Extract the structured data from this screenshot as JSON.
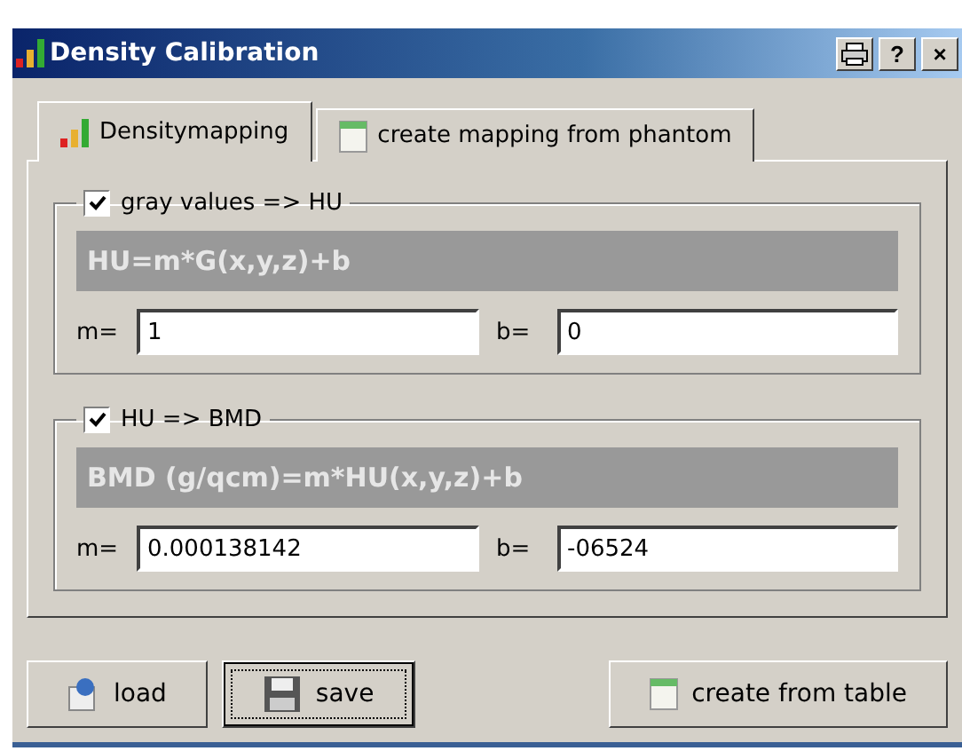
{
  "window": {
    "title": "Density Calibration",
    "controls": [
      {
        "kind": "print"
      },
      {
        "kind": "help",
        "label": "?"
      },
      {
        "kind": "close",
        "label": "×"
      }
    ]
  },
  "tabs": [
    {
      "label": "Densitymapping",
      "kind": "bars",
      "selected": true
    },
    {
      "label": "create mapping from phantom",
      "kind": "table",
      "selected": false
    }
  ],
  "groups": [
    {
      "label": "gray values => HU",
      "checked": true,
      "formula": "HU=m*G(x,y,z)+b",
      "fields": [
        {
          "label": "m=",
          "value": "1"
        },
        {
          "label": "b=",
          "value": "0"
        }
      ]
    },
    {
      "label": "HU => BMD",
      "checked": true,
      "formula": "BMD (g/qcm)=m*HU(x,y,z)+b",
      "fields": [
        {
          "label": "m=",
          "value": "0.000138142"
        },
        {
          "label": "b=",
          "value": "-06524"
        }
      ]
    }
  ],
  "buttons": [
    {
      "label": "load",
      "kind": "load",
      "focused": false
    },
    {
      "label": "save",
      "kind": "disk",
      "focused": true
    },
    {
      "label": "create from table",
      "kind": "table",
      "focused": false
    }
  ]
}
